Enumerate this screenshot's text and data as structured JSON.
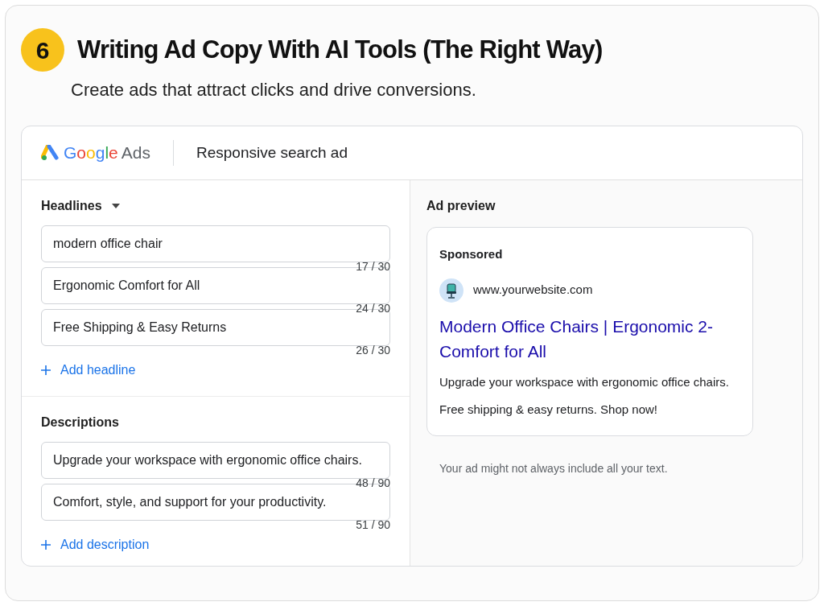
{
  "step": {
    "number": "6",
    "title": "Writing Ad Copy With AI Tools (The Right Way)",
    "subtitle": "Create ads that attract clicks and drive conversions."
  },
  "header": {
    "logo_word": "Google",
    "logo_product": "Ads",
    "title": "Responsive search ad"
  },
  "headlines": {
    "label": "Headlines",
    "fields": [
      {
        "value": "modern office chair",
        "counter": "17 / 30"
      },
      {
        "value": "Ergonomic Comfort for All",
        "counter": "24 / 30"
      },
      {
        "value": "Free Shipping & Easy Returns",
        "counter": "26 / 30"
      }
    ],
    "add": "Add headline"
  },
  "descriptions": {
    "label": "Descriptions",
    "fields": [
      {
        "value": "Upgrade your workspace with ergonomic office chairs.",
        "counter": "48 / 90"
      },
      {
        "value": "Comfort, style, and support for your productivity.",
        "counter": "51 / 90"
      }
    ],
    "add": "Add description"
  },
  "preview": {
    "label": "Ad preview",
    "sponsored": "Sponsored",
    "url": "www.yourwebsite.com",
    "headline": "Modern Office Chairs | Ergonomic 2-Comfort for All",
    "lines": [
      "Upgrade your workspace with ergonomic office chairs.",
      "Free shipping & easy returns. Shop now!"
    ],
    "note": "Your ad might not always include all your text."
  }
}
